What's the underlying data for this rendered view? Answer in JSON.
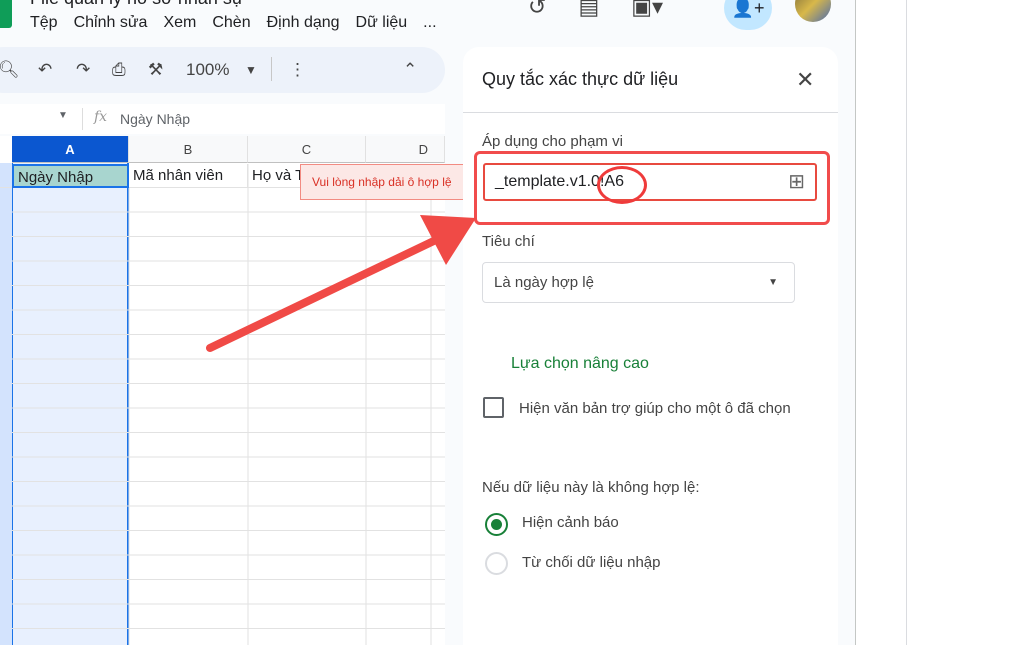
{
  "doc": {
    "title": "File quản lý hồ sơ nhân sự"
  },
  "menu": [
    "Tệp",
    "Chỉnh sửa",
    "Xem",
    "Chèn",
    "Định dạng",
    "Dữ liệu",
    "..."
  ],
  "toolbar": {
    "zoom": "100%"
  },
  "formula_bar": {
    "fx": "fx",
    "value": "Ngày Nhập"
  },
  "grid": {
    "columns": [
      "A",
      "B",
      "C",
      "D"
    ],
    "row1": [
      "Ngày Nhập",
      "Mã nhân viên",
      "Họ và T"
    ]
  },
  "tooltip": "Vui lòng nhập dải ô hợp lệ",
  "panel": {
    "title": "Quy tắc xác thực dữ liệu",
    "range_label": "Áp dụng cho phạm vi",
    "range_value": "_template.v1.0!A6",
    "criteria_label": "Tiêu chí",
    "criteria_value": "Là ngày hợp lệ",
    "advanced": "Lựa chọn nâng cao",
    "help_text_checkbox": "Hiện văn bản trợ giúp cho một ô đã chọn",
    "invalid_label": "Nếu dữ liệu này là không hợp lệ:",
    "options": [
      "Hiện cảnh báo",
      "Từ chối dữ liệu nhập"
    ]
  }
}
